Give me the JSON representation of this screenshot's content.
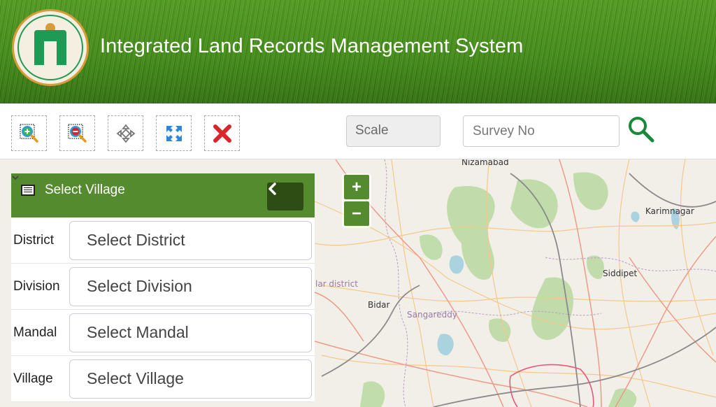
{
  "header": {
    "title": "Integrated Land Records Management System",
    "emblem_alt": "Government of Telangana"
  },
  "toolbar": {
    "tools": [
      {
        "name": "zoom-in-box",
        "icon": "zoom-in-box-icon"
      },
      {
        "name": "zoom-out-box",
        "icon": "zoom-out-box-icon"
      },
      {
        "name": "pan",
        "icon": "pan-icon"
      },
      {
        "name": "full-extent",
        "icon": "full-extent-icon"
      },
      {
        "name": "clear",
        "icon": "close-icon"
      }
    ],
    "scale_label": "Scale",
    "survey_placeholder": "Survey No",
    "survey_value": "",
    "search_icon": "search-icon"
  },
  "map": {
    "zoom_in": "+",
    "zoom_out": "−",
    "labels": [
      {
        "text": "Nizamabad",
        "style": "dark"
      },
      {
        "text": "Karimnagar",
        "style": "dark"
      },
      {
        "text": "Siddipet",
        "style": "dark"
      },
      {
        "text": "Bidar",
        "style": "dark"
      },
      {
        "text": "Sangareddy",
        "style": "purple"
      },
      {
        "text": "lar district",
        "style": "purple"
      }
    ]
  },
  "panel": {
    "title": "Select Village",
    "fields": [
      {
        "label": "District",
        "value": "Select District"
      },
      {
        "label": "Division",
        "value": "Select Division"
      },
      {
        "label": "Mandal",
        "value": "Select Mandal"
      },
      {
        "label": "Village",
        "value": "Select Village"
      }
    ]
  },
  "colors": {
    "primary_green": "#558b2f",
    "dark_green": "#2e4d15",
    "search_green": "#1a8a3a",
    "clear_red": "#d9262a"
  }
}
